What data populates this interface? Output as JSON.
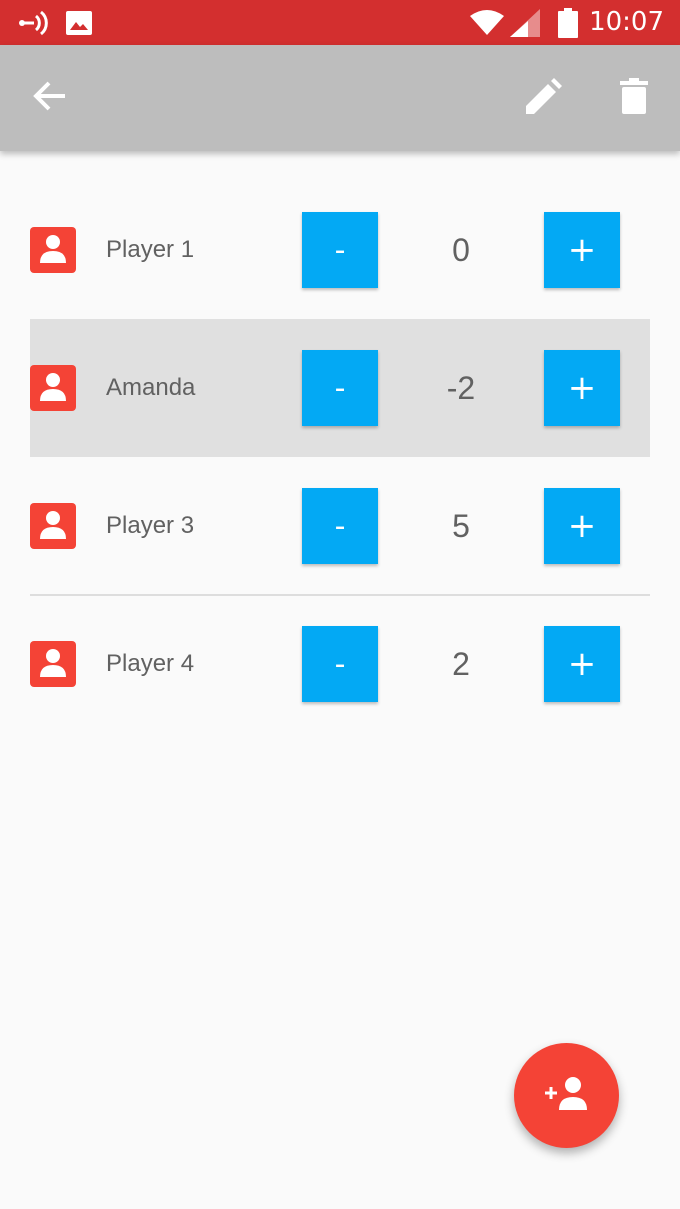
{
  "status_bar": {
    "time": "10:07",
    "icons": [
      "cast-icon",
      "image-icon",
      "wifi-icon",
      "signal-icon",
      "battery-icon"
    ],
    "color": "#d32f2f"
  },
  "app_bar": {
    "back_icon": "arrow-back-icon",
    "edit_icon": "pencil-icon",
    "delete_icon": "trash-icon",
    "color": "#bdbdbd"
  },
  "players": [
    {
      "name": "Player 1",
      "score": "0",
      "minus_label": "-",
      "plus_label": "+"
    },
    {
      "name": "Amanda",
      "score": "-2",
      "minus_label": "-",
      "plus_label": "+"
    },
    {
      "name": "Player 3",
      "score": "5",
      "minus_label": "-",
      "plus_label": "+"
    },
    {
      "name": "Player 4",
      "score": "2",
      "minus_label": "-",
      "plus_label": "+"
    }
  ],
  "colors": {
    "accent_button": "#03a9f4",
    "avatar": "#f44336",
    "fab": "#f44336",
    "highlight_row": "#e0e0e0"
  },
  "fab": {
    "icon": "add-person-icon"
  }
}
